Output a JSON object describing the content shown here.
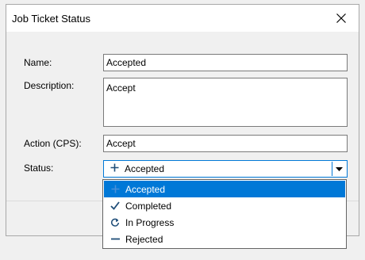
{
  "dialog": {
    "title": "Job Ticket Status",
    "close_icon": "close-icon"
  },
  "form": {
    "name_label": "Name:",
    "name_value": "Accepted",
    "description_label": "Description:",
    "description_value": "Accept",
    "action_label": "Action (CPS):",
    "action_value": "Accept",
    "status_label": "Status:",
    "status_value": "Accepted",
    "status_icon": "plus-icon"
  },
  "status_options": [
    {
      "label": "Accepted",
      "icon": "plus-icon",
      "selected": true
    },
    {
      "label": "Completed",
      "icon": "check-icon",
      "selected": false
    },
    {
      "label": "In Progress",
      "icon": "refresh-icon",
      "selected": false
    },
    {
      "label": "Rejected",
      "icon": "minus-icon",
      "selected": false
    }
  ],
  "colors": {
    "accent": "#0078d7",
    "window_bg": "#f0f0f0",
    "option_icon": "#1f4e79"
  }
}
